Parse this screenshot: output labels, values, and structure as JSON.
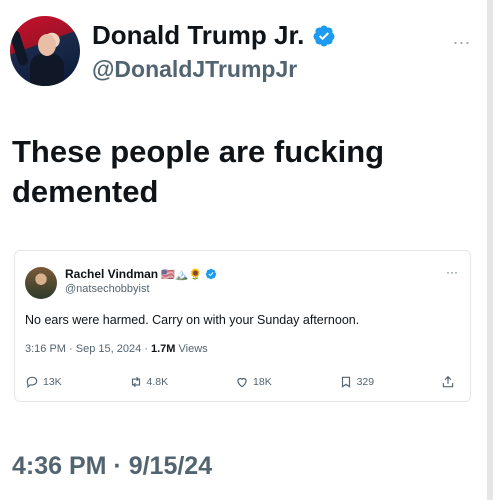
{
  "author": {
    "name": "Donald Trump Jr.",
    "handle": "@DonaldJTrumpJr",
    "verified_icon": "verified-badge-icon",
    "avatar_icon": "profile-photo"
  },
  "menu_glyph": "...",
  "tweet": {
    "text": "These people are fucking demented",
    "timestamp": "4:36 PM · 9/15/24"
  },
  "quoted": {
    "name": "Rachel Vindman",
    "name_emojis": "🇺🇸🏔️🌻",
    "handle": "@natsechobbyist",
    "text": "No ears were harmed. Carry on with your Sunday afternoon.",
    "time": "3:16 PM · Sep 15, 2024 · ",
    "views_count": "1.7M",
    "views_label": " Views",
    "menu_glyph": "···",
    "actions": {
      "replies": "13K",
      "reposts": "4.8K",
      "likes": "18K",
      "bookmarks": "329"
    }
  },
  "colors": {
    "verified_blue": "#1d9bf0",
    "text_primary": "#0f1419",
    "text_secondary": "#536471"
  }
}
